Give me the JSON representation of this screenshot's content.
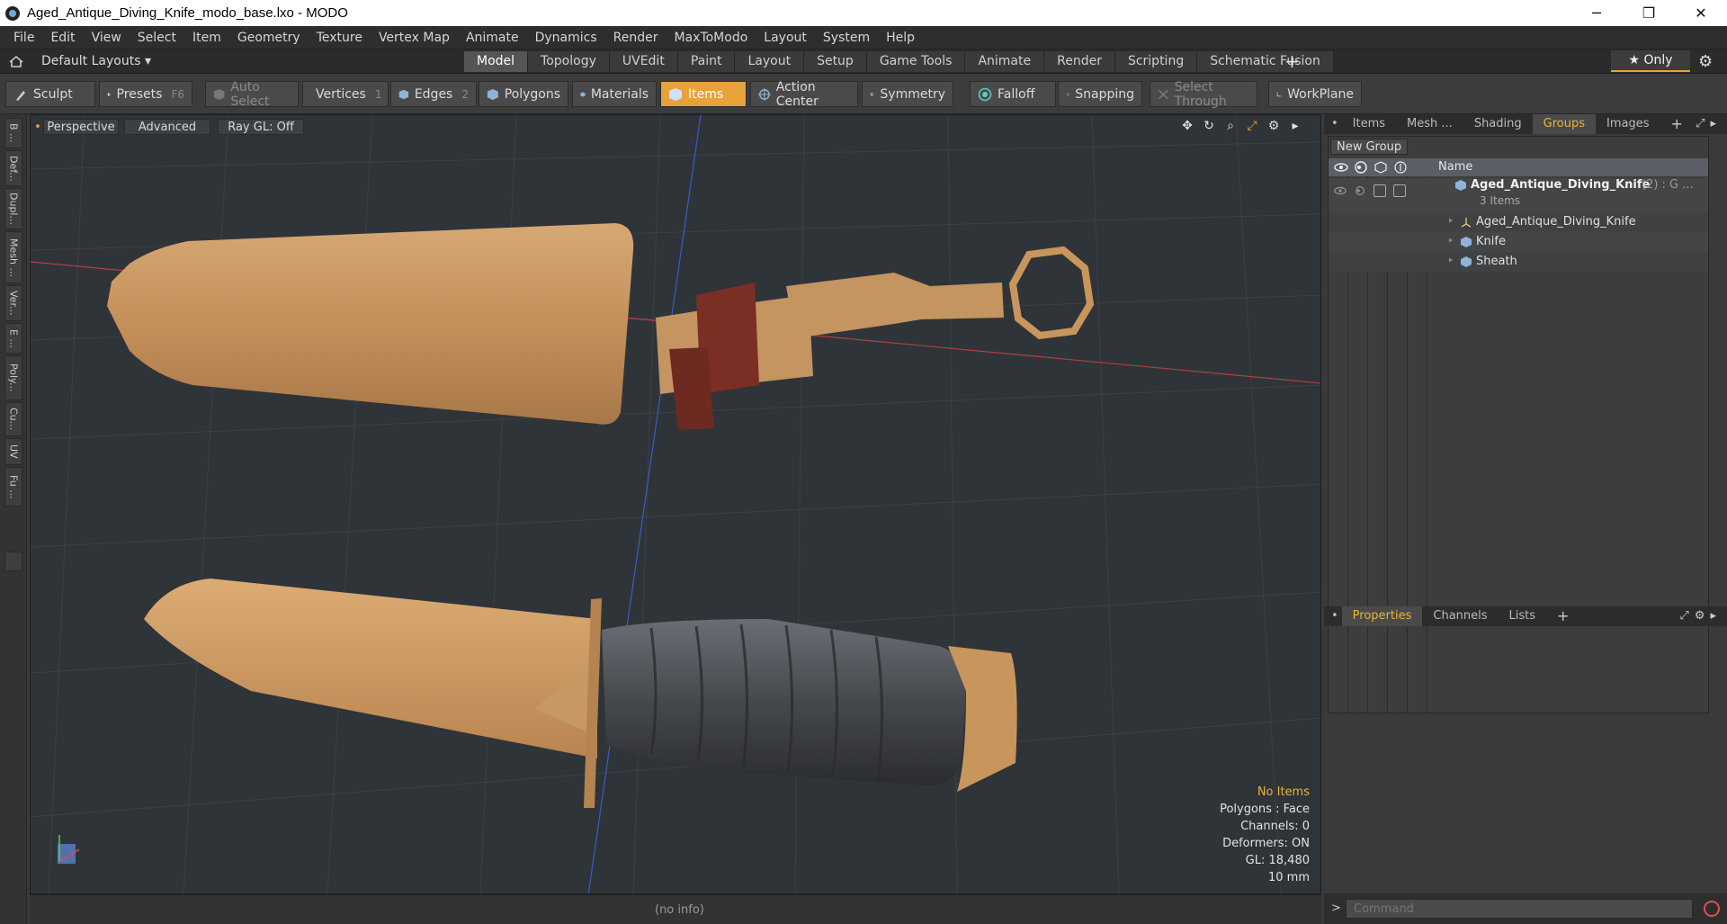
{
  "window": {
    "title": "Aged_Antique_Diving_Knife_modo_base.lxo - MODO",
    "minimize": "─",
    "maximize": "❐",
    "close": "✕"
  },
  "menu": [
    "File",
    "Edit",
    "View",
    "Select",
    "Item",
    "Geometry",
    "Texture",
    "Vertex Map",
    "Animate",
    "Dynamics",
    "Render",
    "MaxToModo",
    "Layout",
    "System",
    "Help"
  ],
  "layoutbar": {
    "default_layouts": "Default Layouts ▾",
    "tabs": [
      "Model",
      "Topology",
      "UVEdit",
      "Paint",
      "Layout",
      "Setup",
      "Game Tools",
      "Animate",
      "Render",
      "Scripting",
      "Schematic Fusion"
    ],
    "active_tab": "Model",
    "plus": "+",
    "only": "★ Only"
  },
  "toolbar": {
    "sculpt": "Sculpt",
    "presets": "Presets",
    "presets_key": "F6",
    "auto_select": "Auto Select",
    "vertices": "Vertices",
    "vertices_count": "1",
    "edges": "Edges",
    "edges_count": "2",
    "polygons": "Polygons",
    "materials": "Materials",
    "items": "Items",
    "action_center": "Action Center",
    "symmetry": "Symmetry",
    "falloff": "Falloff",
    "snapping": "Snapping",
    "select_through": "Select Through",
    "workplane": "WorkPlane"
  },
  "lefttabs": [
    "B ...",
    "Def...",
    "Dupl...",
    "Mesh ...",
    "Ver...",
    "E ...",
    "Poly...",
    "Cu...",
    "UV",
    "Fu ..."
  ],
  "viewport": {
    "perspective": "Perspective",
    "advanced": "Advanced",
    "raygl": "Ray GL: Off",
    "stats": {
      "no_items": "No Items",
      "polygons": "Polygons : Face",
      "channels": "Channels: 0",
      "deformers": "Deformers: ON",
      "gl": "GL: 18,480",
      "scale": "10 mm"
    },
    "colors": {
      "background": "#2f3438",
      "grid": "#3b4146",
      "brass": "#c8955c",
      "handle": "#4a4d52",
      "strap": "#7a2e24"
    }
  },
  "status": {
    "info": "(no info)"
  },
  "groups_panel": {
    "tabs": [
      "Items",
      "Mesh ...",
      "Shading",
      "Groups",
      "Images"
    ],
    "active_tab": "Groups",
    "plus": "+",
    "new_group": "New Group",
    "header_name": "Name",
    "rows": [
      {
        "label": "Aged_Antique_Diving_Knife",
        "suffix": "(2) : G ...",
        "sub": "3 Items"
      },
      {
        "label": "Aged_Antique_Diving_Knife"
      },
      {
        "label": "Knife"
      },
      {
        "label": "Sheath"
      }
    ]
  },
  "props_panel": {
    "tabs": [
      "Properties",
      "Channels",
      "Lists"
    ],
    "active_tab": "Properties",
    "plus": "+"
  },
  "command": {
    "prompt": ">",
    "placeholder": "Command"
  }
}
